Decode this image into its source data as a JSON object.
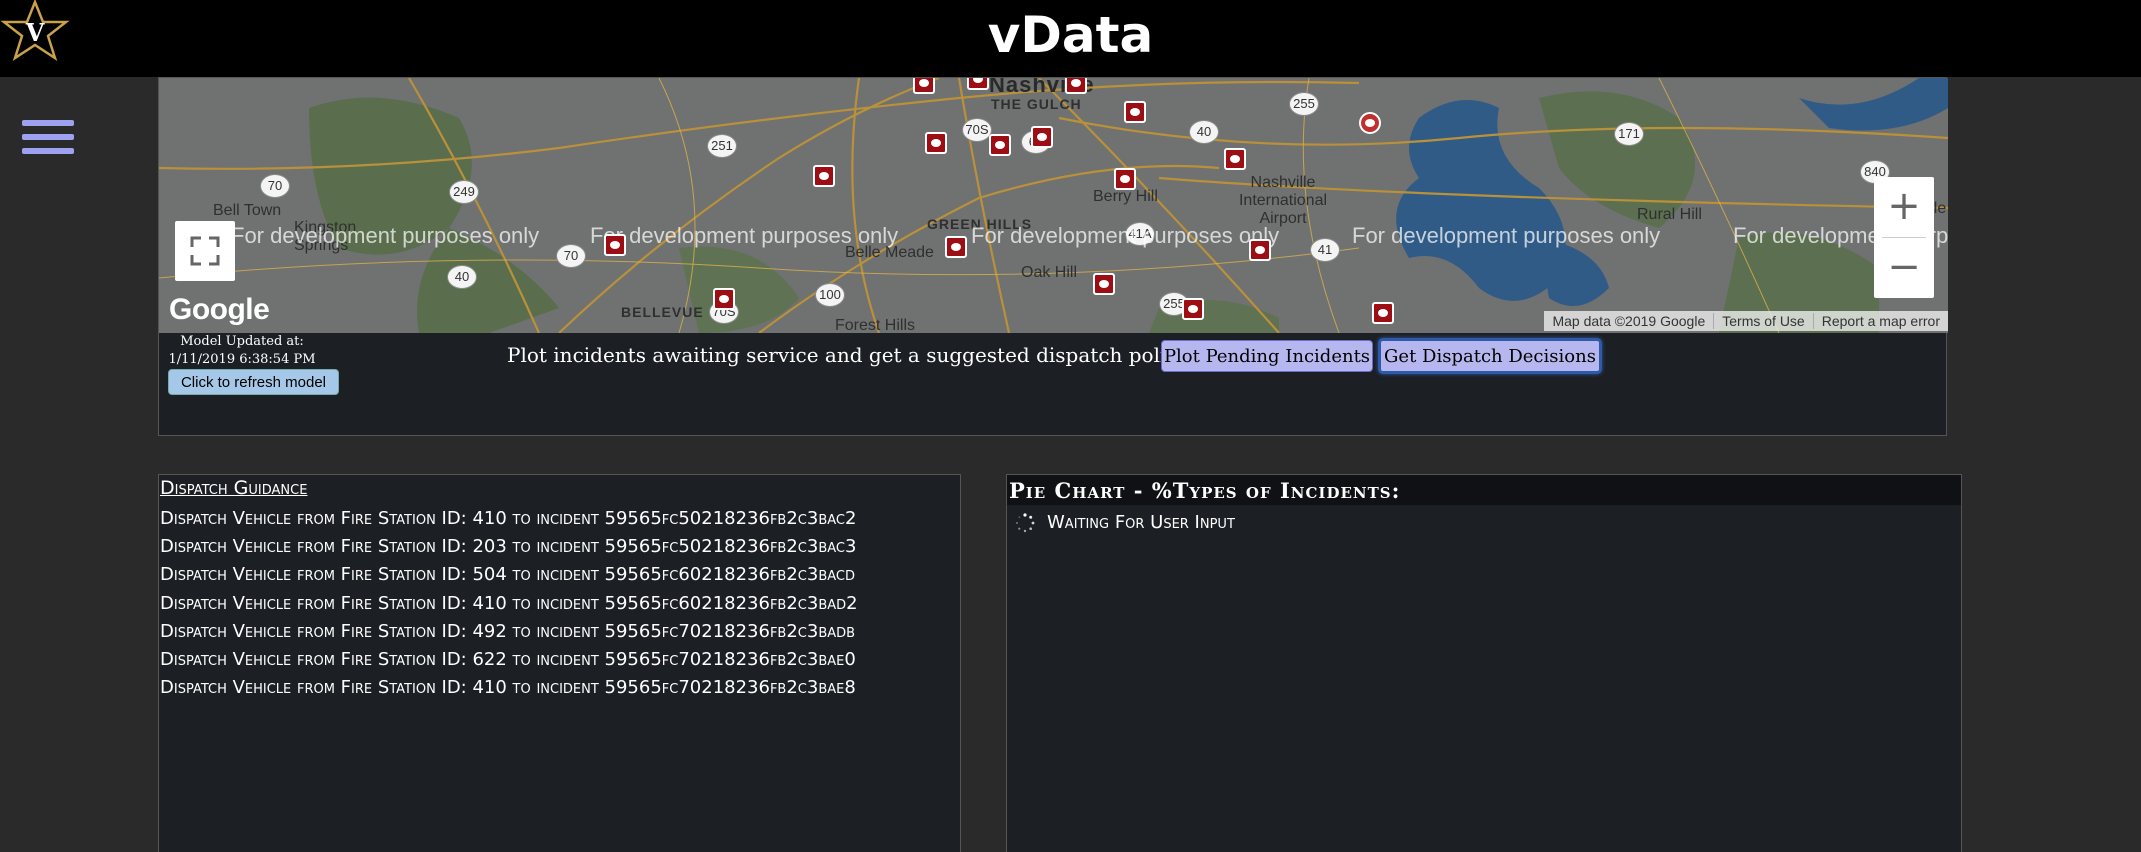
{
  "header": {
    "title": "vData",
    "logo_letter": "V"
  },
  "map": {
    "watermark": "For development purposes only",
    "watermark_partial": "For developme",
    "watermark_partial2": "For developm",
    "labels": {
      "nashville": "Nashville",
      "the_gulch": "THE GULCH",
      "bell_town": "Bell Town",
      "kingston_springs": "Kingston Springs",
      "belle_meade": "Belle Meade",
      "green_hills": "GREEN HILLS",
      "oak_hill": "Oak Hill",
      "berry_hill": "Berry Hill",
      "forest_hills": "Forest Hills",
      "bellevue": "BELLEVUE",
      "nashville_intl": "Nashville International Airport",
      "rural_hill": "Rural Hill",
      "gladeville": "Gladeville"
    },
    "highway_shields": [
      "70",
      "249",
      "251",
      "70S",
      "65",
      "40",
      "255",
      "171",
      "840",
      "70",
      "40",
      "100",
      "41A",
      "255",
      "41",
      "70S"
    ],
    "google_logo": "Google",
    "attribution": [
      "Map data ©2019 Google",
      "Terms of Use",
      "Report a map error"
    ],
    "zoom_in": "+",
    "zoom_out": "−"
  },
  "model": {
    "updated_label": "Model Updated at:",
    "updated_time": "1/11/2019 6:38:54 PM",
    "refresh_label": "Click to refresh model"
  },
  "controls": {
    "prompt": "Plot incidents awaiting service and get a suggested dispatch policy",
    "plot_label": "Plot Pending Incidents",
    "dispatch_label": "Get Dispatch Decisions"
  },
  "guidance": {
    "title": "Dispatch Guidance",
    "items": [
      "Dispatch Vehicle from Fire Station ID: 410 to incident 59565fc50218236fb2c3bac2",
      "Dispatch Vehicle from Fire Station ID: 203 to incident 59565fc50218236fb2c3bac3",
      "Dispatch Vehicle from Fire Station ID: 504 to incident 59565fc60218236fb2c3bacd",
      "Dispatch Vehicle from Fire Station ID: 410 to incident 59565fc60218236fb2c3bad2",
      "Dispatch Vehicle from Fire Station ID: 492 to incident 59565fc70218236fb2c3badb",
      "Dispatch Vehicle from Fire Station ID: 622 to incident 59565fc70218236fb2c3bae0",
      "Dispatch Vehicle from Fire Station ID: 410 to incident 59565fc70218236fb2c3bae8"
    ]
  },
  "pie": {
    "title": "Pie Chart - %Types of Incidents:",
    "status": "Waiting For User Input"
  },
  "colors": {
    "accent": "#9ea0f0",
    "button": "#b7b7f0",
    "marker": "#9c0d14",
    "panel": "#1c1f24"
  }
}
